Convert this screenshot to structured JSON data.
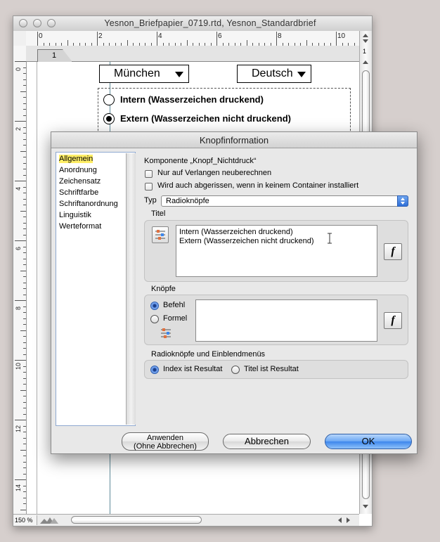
{
  "document_window": {
    "title": "Yesnon_Briefpapier_0719.rtd, Yesnon_Standardbrief",
    "ruler_numbers": [
      "0",
      "2",
      "4",
      "6",
      "8",
      "10"
    ],
    "vertical_ruler_numbers": [
      "0",
      "2",
      "4",
      "6",
      "8",
      "10",
      "12",
      "14"
    ],
    "tab_label": "1",
    "popup_city": "München",
    "popup_language": "Deutsch",
    "radio_intern": "Intern (Wasserzeichen druckend)",
    "radio_extern": "Extern (Wasserzeichen nicht druckend)",
    "zoom": "150 %"
  },
  "dialog": {
    "title": "Knopfinformation",
    "categories": [
      "Allgemein",
      "Anordnung",
      "Zeichensatz",
      "Schriftfarbe",
      "Schriftanordnung",
      "Linguistik",
      "Werteformat"
    ],
    "component_label": "Komponente „Knopf_Nichtdruck“",
    "checkbox_recalc": "Nur auf Verlangen neuberechnen",
    "checkbox_torn": "Wird auch abgerissen, wenn in keinem Container installiert",
    "type_label": "Typ",
    "type_value": "Radioknöpfe",
    "titel_heading": "Titel",
    "titel_lines": [
      "Intern (Wasserzeichen druckend)",
      "Extern (Wasserzeichen nicht druckend)"
    ],
    "knoepfe_heading": "Knöpfe",
    "radio_befehl": "Befehl",
    "radio_formel": "Formel",
    "result_heading": "Radioknöpfe und Einblendmenüs",
    "radio_index": "Index ist Resultat",
    "radio_titel": "Titel ist Resultat",
    "function_symbol": "f",
    "buttons": {
      "apply_line1": "Anwenden",
      "apply_line2": "(Ohne Abbrechen)",
      "cancel": "Abbrechen",
      "ok": "OK"
    }
  },
  "colors": {
    "desktop": "#d6cfcd",
    "selection_highlight": "#ffee66",
    "aqua_blue": "#3d86ec"
  }
}
